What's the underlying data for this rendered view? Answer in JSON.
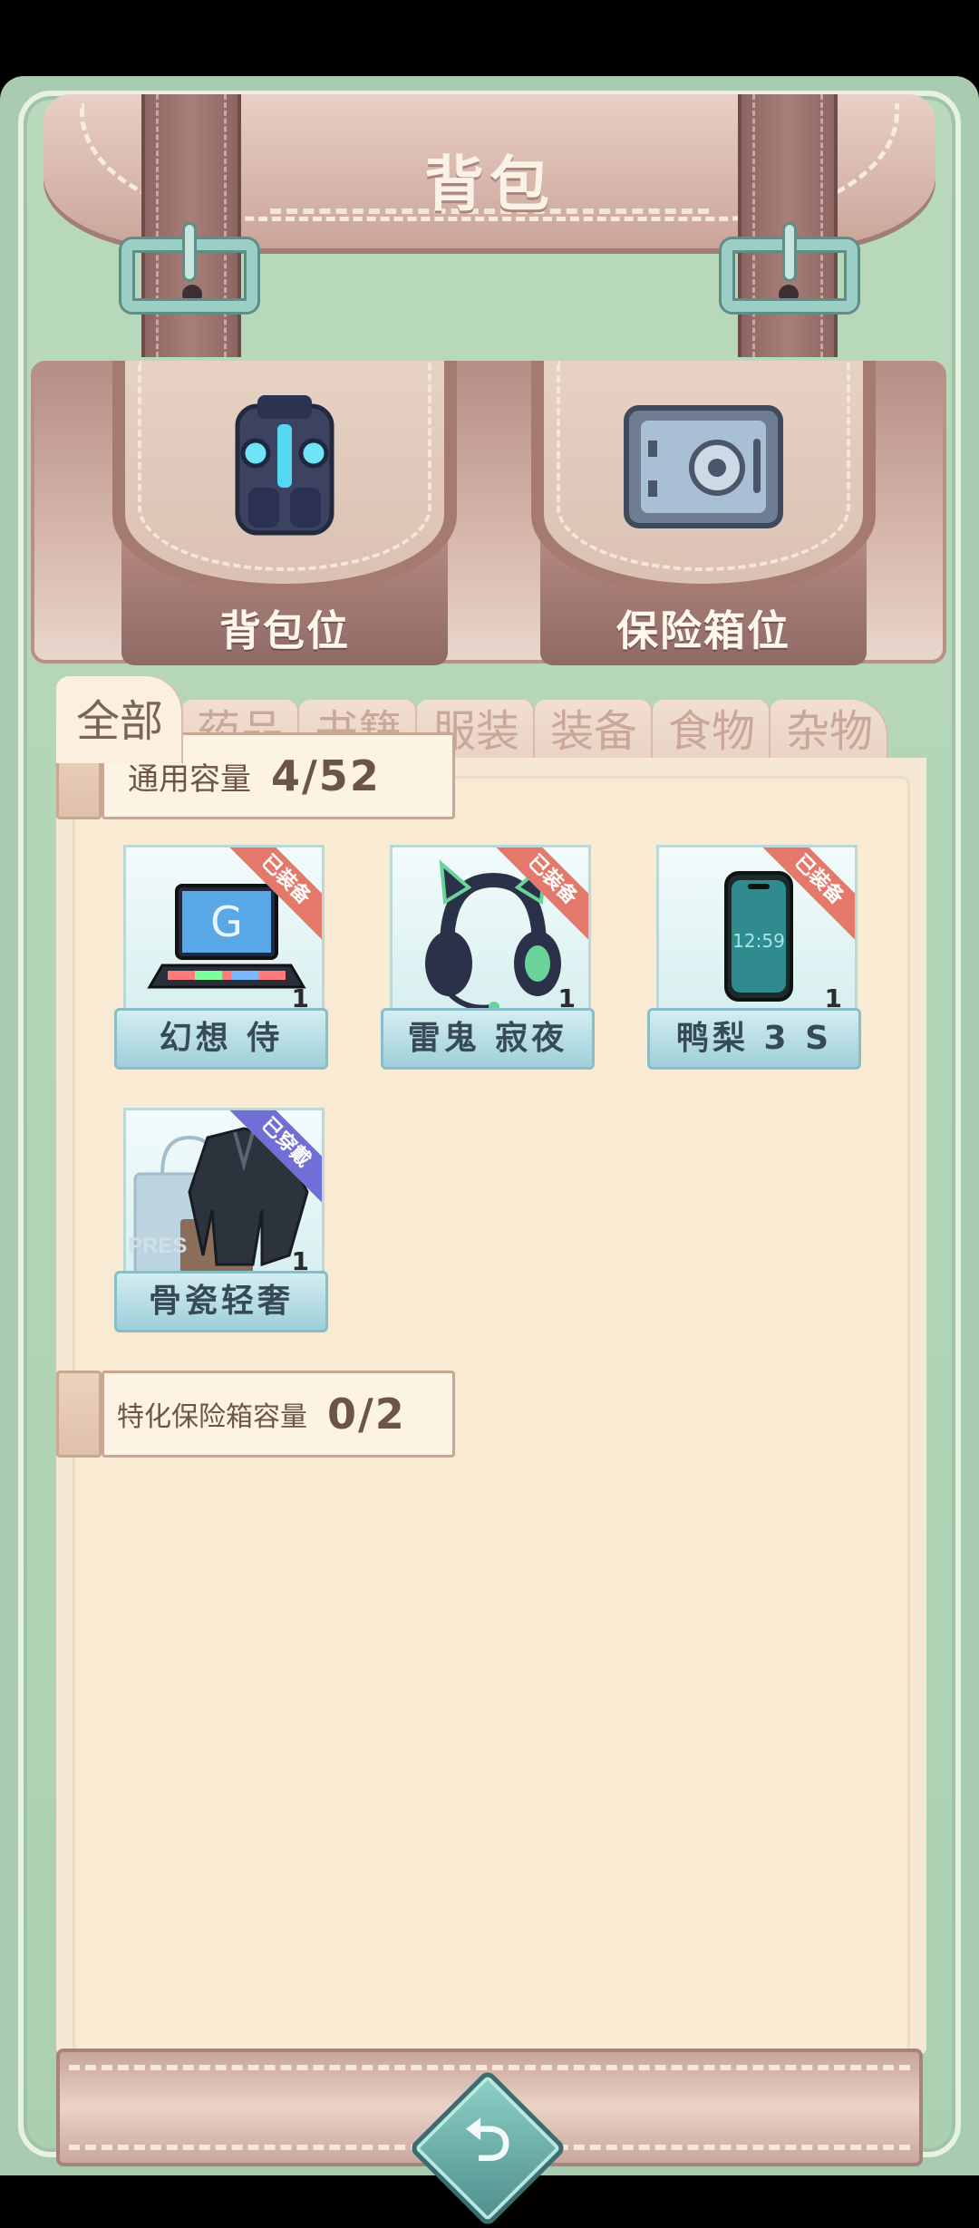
{
  "header": {
    "title": "背包"
  },
  "pockets": [
    {
      "label": "背包位",
      "icon": "backpack-icon"
    },
    {
      "label": "保险箱位",
      "icon": "safe-icon"
    }
  ],
  "tabs": [
    {
      "label": "全部",
      "active": true
    },
    {
      "label": "药品",
      "active": false
    },
    {
      "label": "书籍",
      "active": false
    },
    {
      "label": "服装",
      "active": false
    },
    {
      "label": "装备",
      "active": false
    },
    {
      "label": "食物",
      "active": false
    },
    {
      "label": "杂物",
      "active": false
    }
  ],
  "general_capacity": {
    "name": "通用容量",
    "value": "4/52"
  },
  "items": [
    {
      "name": "幻想 侍",
      "badge": "已装备",
      "count": "1",
      "icon": "laptop-icon",
      "badge_color": "#e4796b"
    },
    {
      "name": "雷鬼 寂夜",
      "badge": "已装备",
      "count": "1",
      "icon": "headphones-icon",
      "badge_color": "#e4796b"
    },
    {
      "name": "鸭梨 3 S",
      "badge": "已装备",
      "count": "1",
      "icon": "phone-icon",
      "badge_color": "#e4796b"
    },
    {
      "name": "骨瓷轻奢",
      "badge": "已穿戴",
      "count": "1",
      "icon": "jacket-icon",
      "badge_color": "#6f6fd6",
      "thumb_text": "PRES"
    }
  ],
  "safe_capacity": {
    "name": "特化保险箱容量",
    "value": "0/2"
  },
  "footer": {
    "back_icon": "return-icon"
  }
}
